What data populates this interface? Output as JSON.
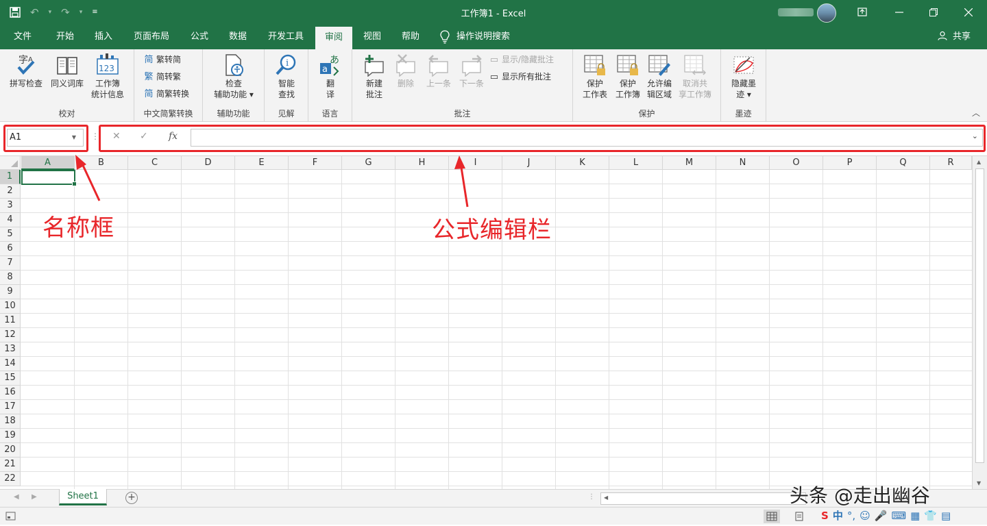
{
  "window": {
    "title": "工作簿1  -  Excel"
  },
  "qat": {
    "save_icon": "save-icon",
    "undo_icon": "undo-icon",
    "redo_icon": "redo-icon"
  },
  "tabs": [
    {
      "label": "文件"
    },
    {
      "label": "开始"
    },
    {
      "label": "插入"
    },
    {
      "label": "页面布局"
    },
    {
      "label": "公式"
    },
    {
      "label": "数据"
    },
    {
      "label": "开发工具"
    },
    {
      "label": "审阅"
    },
    {
      "label": "视图"
    },
    {
      "label": "帮助"
    }
  ],
  "tell_me": "操作说明搜索",
  "share": "共享",
  "ribbon": {
    "proofing": {
      "label": "校对",
      "spell": "拼写检查",
      "thesaurus": "同义词库",
      "stats_1": "工作簿",
      "stats_2": "统计信息"
    },
    "chinese": {
      "label": "中文简繁转换",
      "t2s": "繁转简",
      "s2t": "简转繁",
      "convert": "简繁转换",
      "t2s_glyph": "简",
      "s2t_glyph": "繁",
      "convert_glyph": "简"
    },
    "accessibility": {
      "label": "辅助功能",
      "check_1": "检查",
      "check_2": "辅助功能 ▾"
    },
    "insights": {
      "label": "见解",
      "smart_1": "智能",
      "smart_2": "查找"
    },
    "language": {
      "label": "语言",
      "translate_1": "翻",
      "translate_2": "译"
    },
    "comments": {
      "label": "批注",
      "new_1": "新建",
      "new_2": "批注",
      "delete": "删除",
      "prev": "上一条",
      "next": "下一条",
      "show_hide": "显示/隐藏批注",
      "show_all": "显示所有批注"
    },
    "protect": {
      "label": "保护",
      "sheet_1": "保护",
      "sheet_2": "工作表",
      "book_1": "保护",
      "book_2": "工作簿",
      "ranges_1": "允许编",
      "ranges_2": "辑区域",
      "unshare_1": "取消共",
      "unshare_2": "享工作簿"
    },
    "ink": {
      "label": "墨迹",
      "hide_1": "隐藏墨",
      "hide_2": "迹 ▾"
    }
  },
  "formula_bar": {
    "name_box": "A1",
    "cancel": "✕",
    "enter": "✓",
    "fx": "fx",
    "value": ""
  },
  "grid": {
    "columns": [
      "A",
      "B",
      "C",
      "D",
      "E",
      "F",
      "G",
      "H",
      "I",
      "J",
      "K",
      "L",
      "M",
      "N",
      "O",
      "P",
      "Q",
      "R"
    ],
    "rows": [
      "1",
      "2",
      "3",
      "4",
      "5",
      "6",
      "7",
      "8",
      "9",
      "10",
      "11",
      "12",
      "13",
      "14",
      "15",
      "16",
      "17",
      "18",
      "19",
      "20",
      "21",
      "22"
    ],
    "active_cell": "A1"
  },
  "annotations": {
    "name_box_label": "名称框",
    "formula_bar_label": "公式编辑栏"
  },
  "sheets": [
    {
      "name": "Sheet1"
    }
  ],
  "add_sheet": "+",
  "watermark": "头条 @走出幽谷",
  "ime": {
    "mode": "中"
  },
  "colors": {
    "brand": "#217346",
    "annotation": "#e8262a"
  }
}
